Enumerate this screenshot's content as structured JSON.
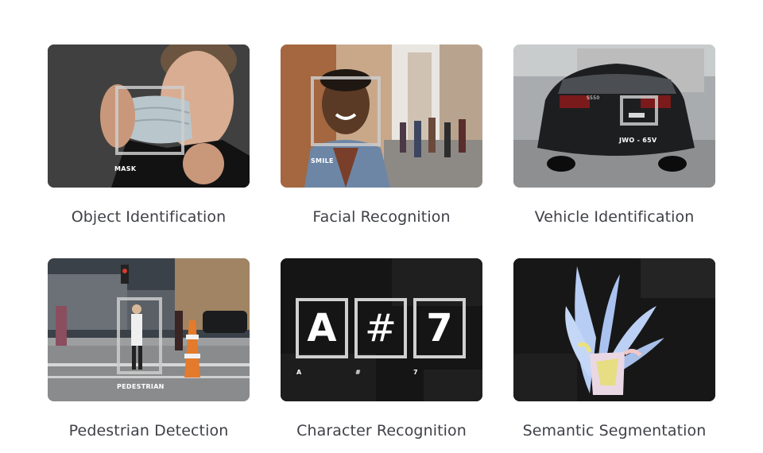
{
  "cards": [
    {
      "caption": "Object Identification",
      "tag": "MASK"
    },
    {
      "caption": "Facial Recognition",
      "tag": "SMILE"
    },
    {
      "caption": "Vehicle Identification",
      "tag": "JWO - 65V",
      "badge": "S550"
    },
    {
      "caption": "Pedestrian Detection",
      "tag": "PEDESTRIAN"
    },
    {
      "caption": "Character Recognition",
      "chars": [
        "A",
        "#",
        "7"
      ],
      "labels": [
        "A",
        "#",
        "7"
      ]
    },
    {
      "caption": "Semantic Segmentation"
    }
  ],
  "colors": {
    "caption": "#3f4147",
    "box": "#cdcdcd",
    "dark_tile": "#141414"
  }
}
